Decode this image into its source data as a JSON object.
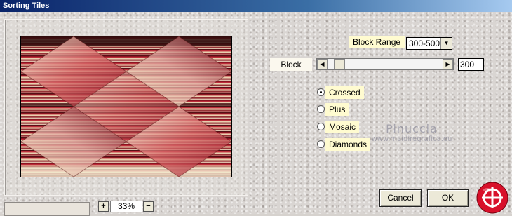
{
  "window": {
    "title": "Sorting Tiles"
  },
  "zoom": {
    "plus_label": "+",
    "minus_label": "−",
    "value": "33%"
  },
  "controls": {
    "block_range_label": "Block Range",
    "block_range_selected": "300-500",
    "block_label": "Block",
    "block_value": "300",
    "block_slider_fraction": 0.06
  },
  "radio_options": [
    {
      "label": "Crossed",
      "selected": true
    },
    {
      "label": "Plus",
      "selected": false
    },
    {
      "label": "Mosaic",
      "selected": false
    },
    {
      "label": "Diamonds",
      "selected": false
    }
  ],
  "watermark": {
    "name": "Pinuccia",
    "url": "www.maidiregrafica.eu"
  },
  "buttons": {
    "cancel": "Cancel",
    "ok": "OK"
  },
  "icons": {
    "combo_arrow": "chevron-down-icon",
    "scroll_left": "arrow-left-icon",
    "scroll_right": "arrow-right-icon",
    "logo": "corel-balloon-logo-icon"
  },
  "colors": {
    "title_bar": "#0a246a",
    "label_highlight": "#fffbd0",
    "preview_red": "#b5162a",
    "preview_cream": "#f2e6c0",
    "logo_red": "#d8102a"
  }
}
